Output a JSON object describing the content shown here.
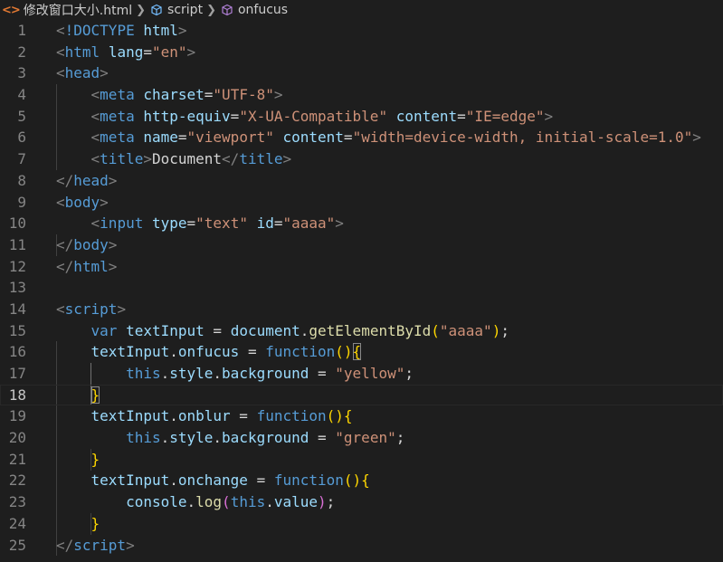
{
  "breadcrumb": {
    "file_name": "修改窗口大小.html",
    "file_icon": "html-icon",
    "items": [
      {
        "label": "script",
        "icon": "symbol-structure-icon"
      },
      {
        "label": "onfucus",
        "icon": "symbol-method-icon"
      }
    ]
  },
  "editor": {
    "current_line": 18,
    "colors": {
      "background": "#1e1e1e",
      "tag": "#569cd6",
      "attribute": "#9cdcfe",
      "string": "#ce9178",
      "function": "#dcdcaa",
      "keyword": "#569cd6",
      "line_number": "#858585"
    },
    "lines": [
      {
        "n": "1",
        "tokens": [
          [
            "t-punct",
            "<"
          ],
          [
            "t-tag",
            "!DOCTYPE"
          ],
          [
            "t-text",
            " "
          ],
          [
            "t-attr",
            "html"
          ],
          [
            "t-punct",
            ">"
          ]
        ]
      },
      {
        "n": "2",
        "tokens": [
          [
            "t-punct",
            "<"
          ],
          [
            "t-tag",
            "html"
          ],
          [
            "t-text",
            " "
          ],
          [
            "t-attr",
            "lang"
          ],
          [
            "t-text",
            "="
          ],
          [
            "t-str",
            "\"en\""
          ],
          [
            "t-punct",
            ">"
          ]
        ]
      },
      {
        "n": "3",
        "tokens": [
          [
            "t-punct",
            "<"
          ],
          [
            "t-tag",
            "head"
          ],
          [
            "t-punct",
            ">"
          ]
        ]
      },
      {
        "n": "4",
        "tokens": [
          [
            "t-text",
            "    "
          ],
          [
            "t-punct",
            "<"
          ],
          [
            "t-tag",
            "meta"
          ],
          [
            "t-text",
            " "
          ],
          [
            "t-attr",
            "charset"
          ],
          [
            "t-text",
            "="
          ],
          [
            "t-str",
            "\"UTF-8\""
          ],
          [
            "t-punct",
            ">"
          ]
        ]
      },
      {
        "n": "5",
        "tokens": [
          [
            "t-text",
            "    "
          ],
          [
            "t-punct",
            "<"
          ],
          [
            "t-tag",
            "meta"
          ],
          [
            "t-text",
            " "
          ],
          [
            "t-attr",
            "http-equiv"
          ],
          [
            "t-text",
            "="
          ],
          [
            "t-str",
            "\"X-UA-Compatible\""
          ],
          [
            "t-text",
            " "
          ],
          [
            "t-attr",
            "content"
          ],
          [
            "t-text",
            "="
          ],
          [
            "t-str",
            "\"IE=edge\""
          ],
          [
            "t-punct",
            ">"
          ]
        ]
      },
      {
        "n": "6",
        "tokens": [
          [
            "t-text",
            "    "
          ],
          [
            "t-punct",
            "<"
          ],
          [
            "t-tag",
            "meta"
          ],
          [
            "t-text",
            " "
          ],
          [
            "t-attr",
            "name"
          ],
          [
            "t-text",
            "="
          ],
          [
            "t-str",
            "\"viewport\""
          ],
          [
            "t-text",
            " "
          ],
          [
            "t-attr",
            "content"
          ],
          [
            "t-text",
            "="
          ],
          [
            "t-str",
            "\"width=device-width, initial-scale=1.0\""
          ],
          [
            "t-punct",
            ">"
          ]
        ]
      },
      {
        "n": "7",
        "tokens": [
          [
            "t-text",
            "    "
          ],
          [
            "t-punct",
            "<"
          ],
          [
            "t-tag",
            "title"
          ],
          [
            "t-punct",
            ">"
          ],
          [
            "t-text",
            "Document"
          ],
          [
            "t-punct",
            "</"
          ],
          [
            "t-tag",
            "title"
          ],
          [
            "t-punct",
            ">"
          ]
        ]
      },
      {
        "n": "8",
        "tokens": [
          [
            "t-punct",
            "</"
          ],
          [
            "t-tag",
            "head"
          ],
          [
            "t-punct",
            ">"
          ]
        ]
      },
      {
        "n": "9",
        "tokens": [
          [
            "t-punct",
            "<"
          ],
          [
            "t-tag",
            "body"
          ],
          [
            "t-punct",
            ">"
          ]
        ]
      },
      {
        "n": "10",
        "tokens": [
          [
            "t-text",
            "    "
          ],
          [
            "t-punct",
            "<"
          ],
          [
            "t-tag",
            "input"
          ],
          [
            "t-text",
            " "
          ],
          [
            "t-attr",
            "type"
          ],
          [
            "t-text",
            "="
          ],
          [
            "t-str",
            "\"text\""
          ],
          [
            "t-text",
            " "
          ],
          [
            "t-attr",
            "id"
          ],
          [
            "t-text",
            "="
          ],
          [
            "t-str",
            "\"aaaa\""
          ],
          [
            "t-punct",
            ">"
          ]
        ]
      },
      {
        "n": "11",
        "tokens": [
          [
            "t-punct",
            "</"
          ],
          [
            "t-tag",
            "body"
          ],
          [
            "t-punct",
            ">"
          ]
        ]
      },
      {
        "n": "12",
        "tokens": [
          [
            "t-punct",
            "</"
          ],
          [
            "t-tag",
            "html"
          ],
          [
            "t-punct",
            ">"
          ]
        ]
      },
      {
        "n": "13",
        "tokens": []
      },
      {
        "n": "14",
        "tokens": [
          [
            "t-punct",
            "<"
          ],
          [
            "t-tag",
            "script"
          ],
          [
            "t-punct",
            ">"
          ]
        ]
      },
      {
        "n": "15",
        "tokens": [
          [
            "t-text",
            "    "
          ],
          [
            "t-kw",
            "var"
          ],
          [
            "t-text",
            " "
          ],
          [
            "t-var",
            "textInput"
          ],
          [
            "t-op",
            " = "
          ],
          [
            "t-var",
            "document"
          ],
          [
            "t-op",
            "."
          ],
          [
            "t-fn",
            "getElementById"
          ],
          [
            "t-brk",
            "("
          ],
          [
            "t-str",
            "\"aaaa\""
          ],
          [
            "t-brk",
            ")"
          ],
          [
            "t-op",
            ";"
          ]
        ]
      },
      {
        "n": "16",
        "tokens": [
          [
            "t-text",
            "    "
          ],
          [
            "t-var",
            "textInput"
          ],
          [
            "t-op",
            "."
          ],
          [
            "t-var",
            "onfucus"
          ],
          [
            "t-op",
            " = "
          ],
          [
            "t-kw",
            "function"
          ],
          [
            "t-brk",
            "()"
          ],
          [
            "t-brk bracket-match",
            "{"
          ]
        ]
      },
      {
        "n": "17",
        "tokens": [
          [
            "t-text",
            "        "
          ],
          [
            "t-kw",
            "this"
          ],
          [
            "t-op",
            "."
          ],
          [
            "t-var",
            "style"
          ],
          [
            "t-op",
            "."
          ],
          [
            "t-var",
            "background"
          ],
          [
            "t-op",
            " = "
          ],
          [
            "t-str",
            "\"yellow\""
          ],
          [
            "t-op",
            ";"
          ]
        ]
      },
      {
        "n": "18",
        "tokens": [
          [
            "t-text",
            "    "
          ],
          [
            "t-brk bracket-match",
            "}"
          ]
        ]
      },
      {
        "n": "19",
        "tokens": [
          [
            "t-text",
            "    "
          ],
          [
            "t-var",
            "textInput"
          ],
          [
            "t-op",
            "."
          ],
          [
            "t-var",
            "onblur"
          ],
          [
            "t-op",
            " = "
          ],
          [
            "t-kw",
            "function"
          ],
          [
            "t-brk",
            "(){"
          ]
        ]
      },
      {
        "n": "20",
        "tokens": [
          [
            "t-text",
            "        "
          ],
          [
            "t-kw",
            "this"
          ],
          [
            "t-op",
            "."
          ],
          [
            "t-var",
            "style"
          ],
          [
            "t-op",
            "."
          ],
          [
            "t-var",
            "background"
          ],
          [
            "t-op",
            " = "
          ],
          [
            "t-str",
            "\"green\""
          ],
          [
            "t-op",
            ";"
          ]
        ]
      },
      {
        "n": "21",
        "tokens": [
          [
            "t-text",
            "    "
          ],
          [
            "t-brk",
            "}"
          ]
        ]
      },
      {
        "n": "22",
        "tokens": [
          [
            "t-text",
            "    "
          ],
          [
            "t-var",
            "textInput"
          ],
          [
            "t-op",
            "."
          ],
          [
            "t-var",
            "onchange"
          ],
          [
            "t-op",
            " = "
          ],
          [
            "t-kw",
            "function"
          ],
          [
            "t-brk",
            "(){"
          ]
        ]
      },
      {
        "n": "23",
        "tokens": [
          [
            "t-text",
            "        "
          ],
          [
            "t-var",
            "console"
          ],
          [
            "t-op",
            "."
          ],
          [
            "t-fn",
            "log"
          ],
          [
            "t-brk2",
            "("
          ],
          [
            "t-kw",
            "this"
          ],
          [
            "t-op",
            "."
          ],
          [
            "t-var",
            "value"
          ],
          [
            "t-brk2",
            ")"
          ],
          [
            "t-op",
            ";"
          ]
        ]
      },
      {
        "n": "24",
        "tokens": [
          [
            "t-text",
            "    "
          ],
          [
            "t-brk",
            "}"
          ]
        ]
      },
      {
        "n": "25",
        "tokens": [
          [
            "t-punct",
            "</"
          ],
          [
            "t-tag",
            "script"
          ],
          [
            "t-punct",
            ">"
          ]
        ]
      }
    ]
  }
}
